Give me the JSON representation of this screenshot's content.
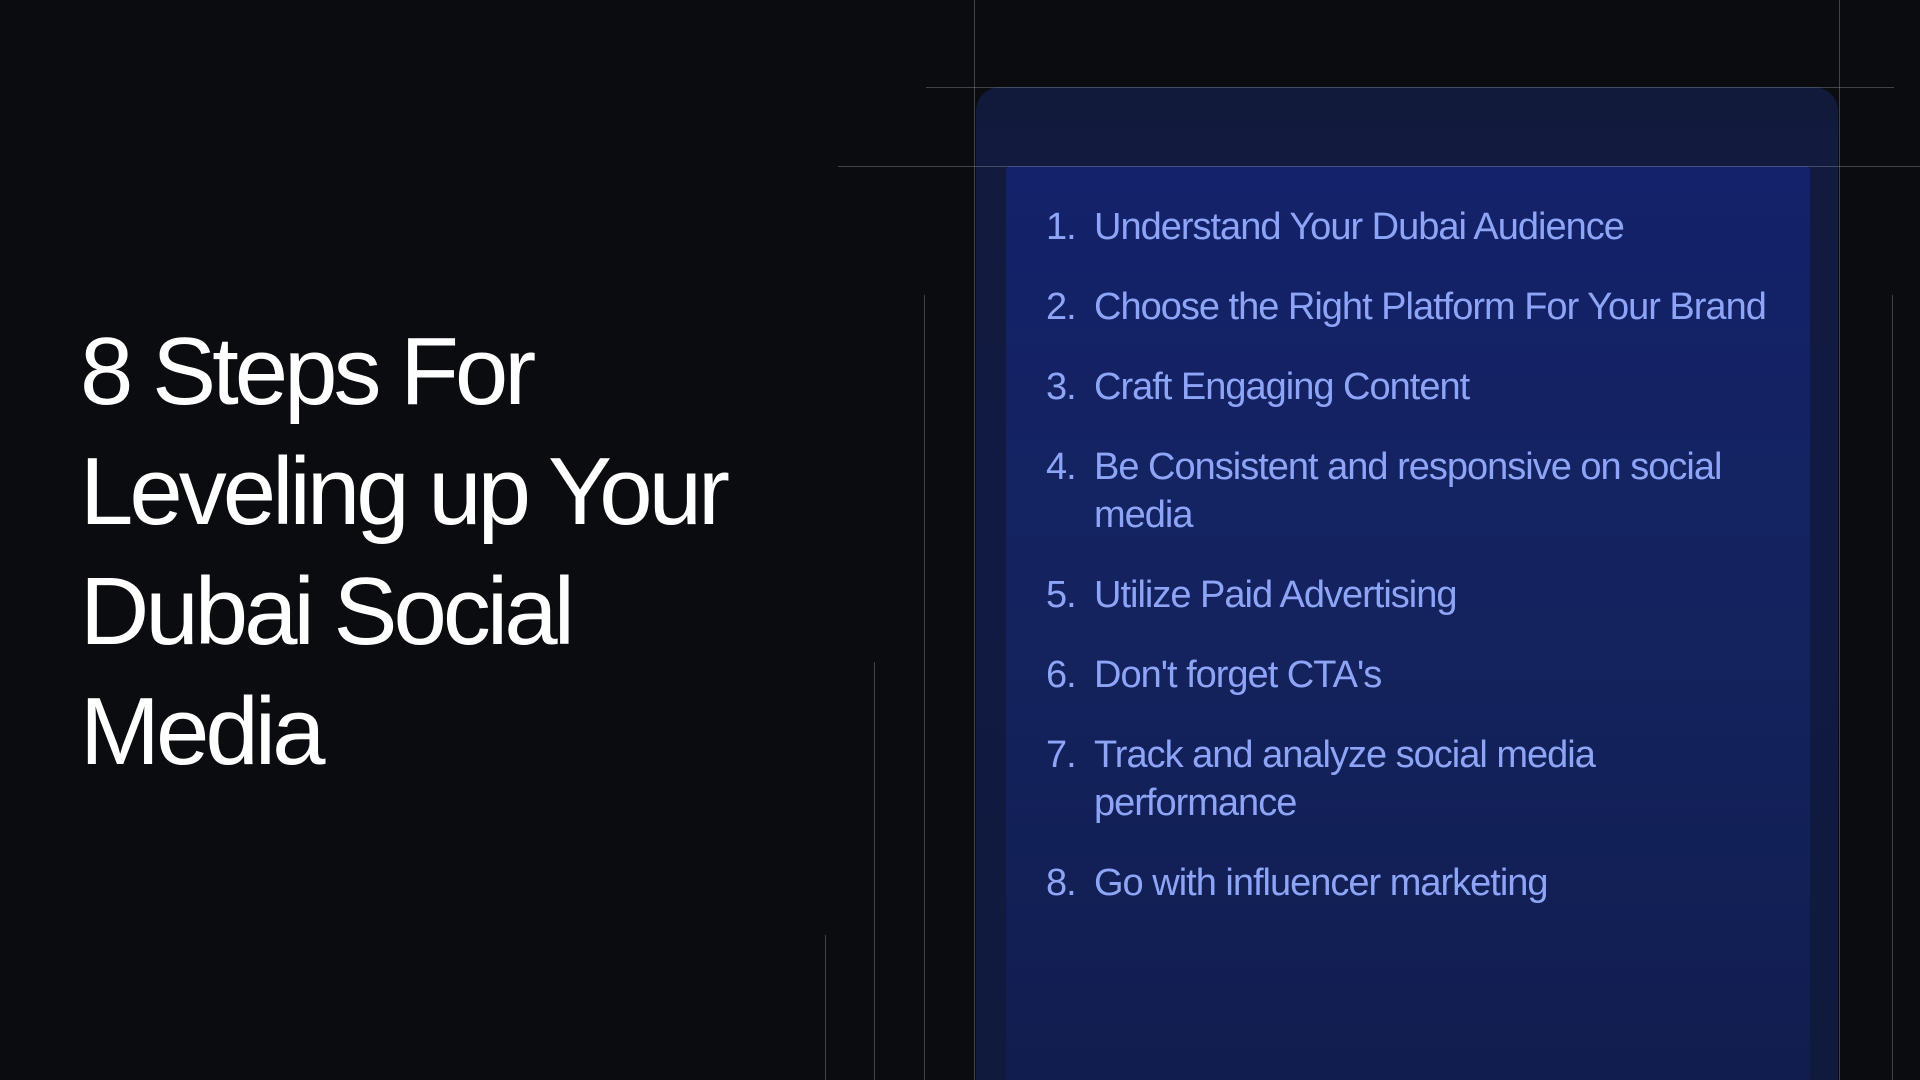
{
  "heading": {
    "line1": "8 Steps For",
    "line2": "Leveling up Your",
    "line3": "Dubai Social",
    "line4": "Media"
  },
  "steps": [
    {
      "num": "1.",
      "text": "Understand Your Dubai Audience"
    },
    {
      "num": "2.",
      "text": "Choose the Right Platform For Your Brand"
    },
    {
      "num": "3.",
      "text": "Craft Engaging Content"
    },
    {
      "num": "4.",
      "text": "Be Consistent and responsive on social media"
    },
    {
      "num": "5.",
      "text": "Utilize Paid Advertising"
    },
    {
      "num": "6.",
      "text": "Don't forget CTA's"
    },
    {
      "num": "7.",
      "text": "Track and analyze social media performance"
    },
    {
      "num": "8.",
      "text": "Go with influencer marketing"
    }
  ],
  "colors": {
    "background": "#0b0c0f",
    "heading_text": "#ffffff",
    "step_text": "#8ea5f7",
    "panel": "#13226a"
  }
}
